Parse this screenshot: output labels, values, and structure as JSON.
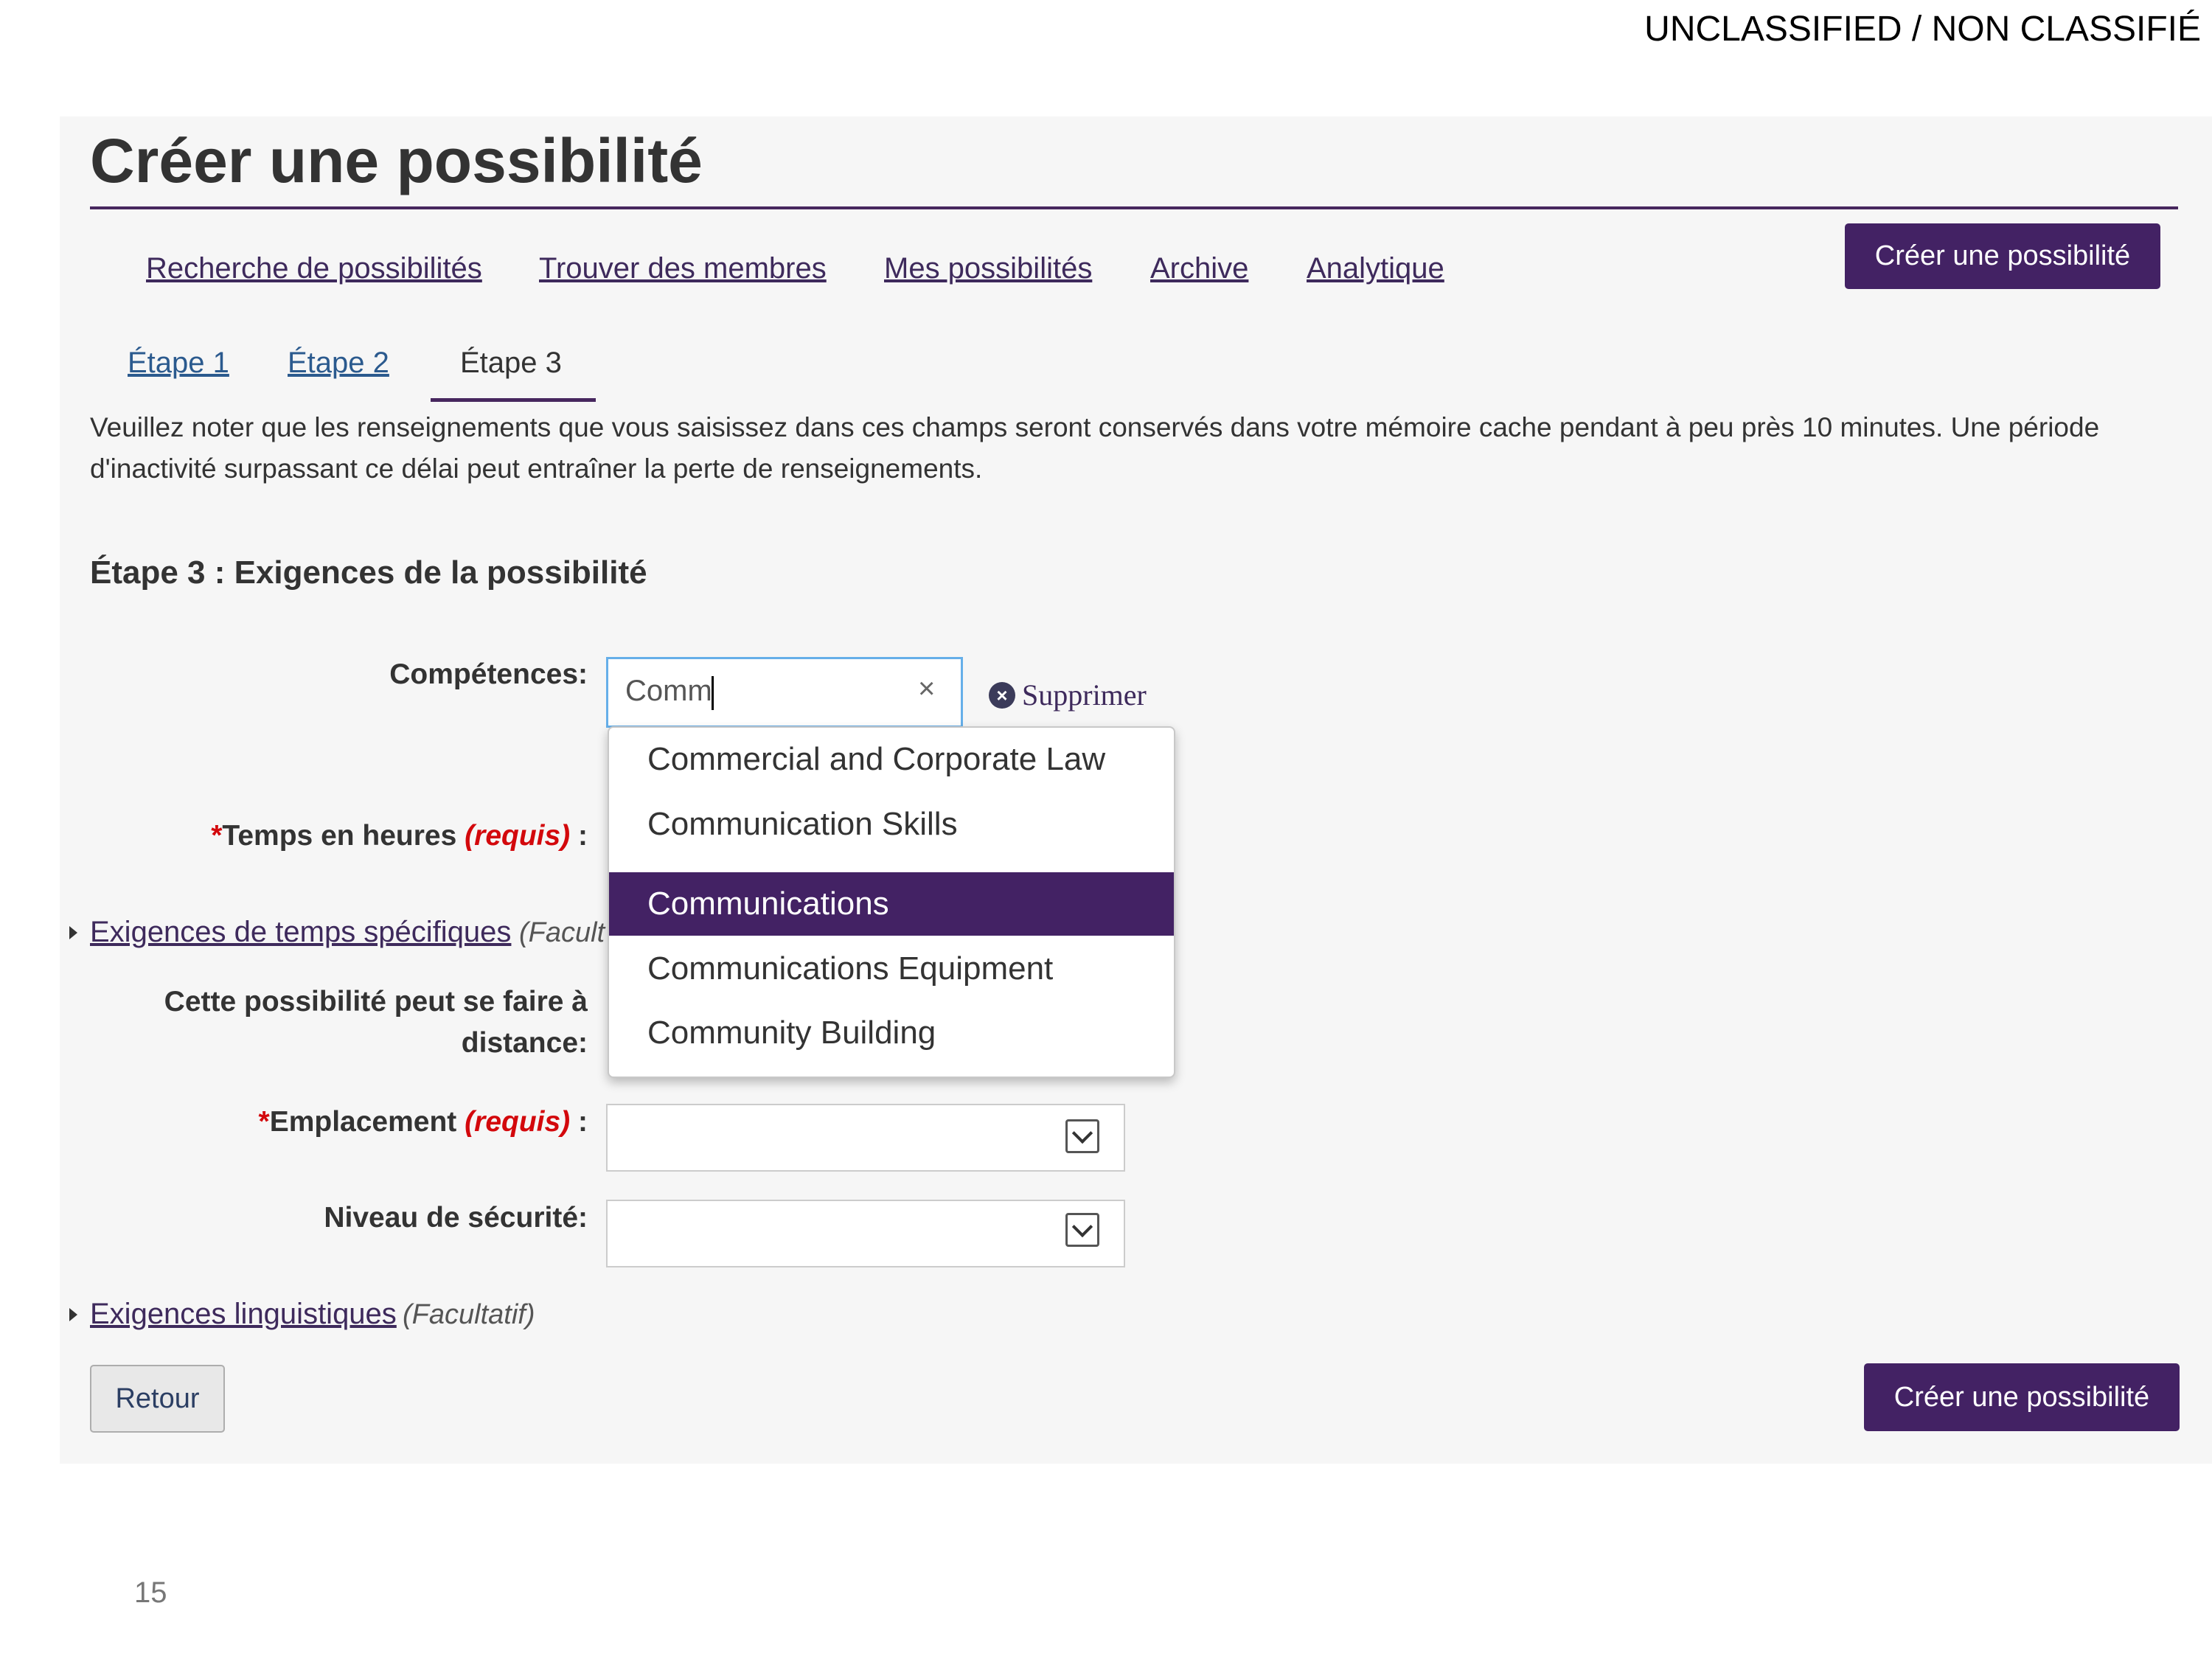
{
  "classification": "UNCLASSIFIED / NON CLASSIFIÉ",
  "page_title": "Créer une possibilité",
  "nav": {
    "links": [
      "Recherche de possibilités",
      "Trouver des membres",
      "Mes possibilités",
      "Archive",
      "Analytique"
    ],
    "create_button": "Créer une possibilité"
  },
  "steps": {
    "tabs": [
      "Étape 1",
      "Étape 2",
      "Étape 3"
    ],
    "active": "Étape 3"
  },
  "notice": "Veuillez noter que les renseignements que vous saisissez dans ces champs seront conservés dans votre mémoire cache pendant à peu près 10 minutes. Une période d'inactivité surpassant ce délai peut entraîner la perte de renseignements.",
  "section_title": "Étape 3 : Exigences de la possibilité",
  "form": {
    "skills": {
      "label": "Compétences:",
      "value": "Comm",
      "clear_glyph": "×",
      "remove_label": "Supprimer",
      "suggestions": [
        "Commercial and Corporate Law",
        "Communication Skills",
        "Communications",
        "Communications Equipment",
        "Community Building"
      ],
      "highlighted": "Communications"
    },
    "hours": {
      "star": "*",
      "label": "Temps en heures",
      "required": "(requis)",
      "colon": " :"
    },
    "specific_time": {
      "link": "Exigences de temps spécifiques",
      "optional": "(Facult"
    },
    "remote": {
      "label_line1": "Cette possibilité peut se faire à",
      "label_line2": "distance:"
    },
    "location": {
      "star": "*",
      "label": "Emplacement",
      "required": "(requis)",
      "colon": " :",
      "value": ""
    },
    "security": {
      "label": "Niveau de sécurité:",
      "value": ""
    },
    "language": {
      "link": "Exigences linguistiques",
      "optional": "(Facultatif)"
    }
  },
  "footer": {
    "back_button": "Retour",
    "create_button": "Créer une possibilité"
  },
  "page_number": "15",
  "colors": {
    "brand_purple": "#432264",
    "link_purple": "#3e2a5c",
    "required_red": "#d3080c",
    "focus_blue": "#66afe9"
  }
}
